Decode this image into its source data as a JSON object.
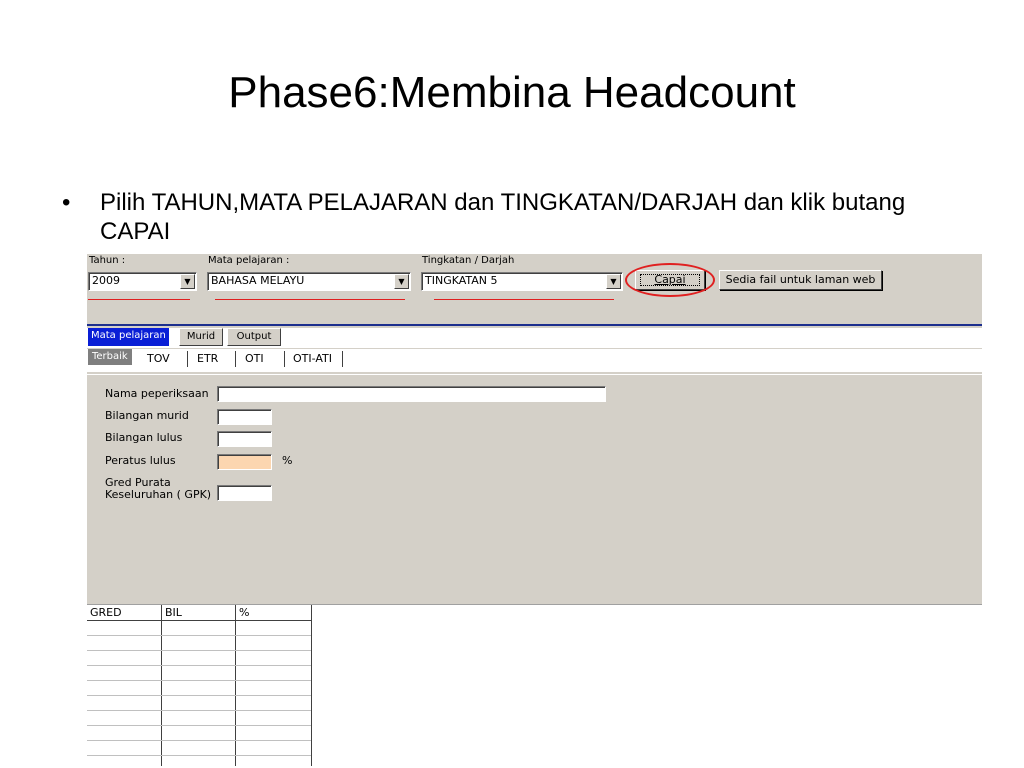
{
  "slide": {
    "title": "Phase6:Membina Headcount",
    "bullet_dot": "•",
    "bullet_text": "Pilih TAHUN,MATA PELAJARAN dan TINGKATAN/DARJAH dan klik butang CAPAI"
  },
  "toolbar": {
    "tahun_label": "Tahun :",
    "tahun_value": "2009",
    "mata_label": "Mata pelajaran :",
    "mata_value": "BAHASA MELAYU",
    "tingkatan_label": "Tingkatan / Darjah",
    "tingkatan_value": "TINGKATAN 5",
    "capai_label": "Capai",
    "sedia_label": "Sedia fail untuk laman web",
    "dropdown_glyph": "▼",
    "highlight_color": "#e02020"
  },
  "tabs_main": [
    "Mata pelajaran",
    "Murid",
    "Output"
  ],
  "tabs_sub": [
    "Terbaik",
    "TOV",
    "ETR",
    "OTI",
    "OTI-ATI"
  ],
  "form": {
    "nama_label": "Nama peperiksaan",
    "nama_value": "",
    "bilangan_murid_label": "Bilangan murid",
    "bilangan_murid_value": "",
    "bilangan_lulus_label": "Bilangan lulus",
    "bilangan_lulus_value": "",
    "peratus_label": "Peratus lulus",
    "peratus_value": "",
    "percent_sign": "%",
    "gpk_label_line1": "Gred Purata",
    "gpk_label_line2": "Keseluruhan ( GPK)",
    "gpk_value": ""
  },
  "grid": {
    "columns": [
      "GRED",
      "BIL",
      "%"
    ],
    "rows": [
      [],
      [],
      [],
      [],
      [],
      [],
      [],
      [],
      [],
      []
    ]
  },
  "colors": {
    "tab_active": "#0a1fd6",
    "window_bg": "#d4d0c8",
    "peach_field": "#fcd6b0"
  }
}
